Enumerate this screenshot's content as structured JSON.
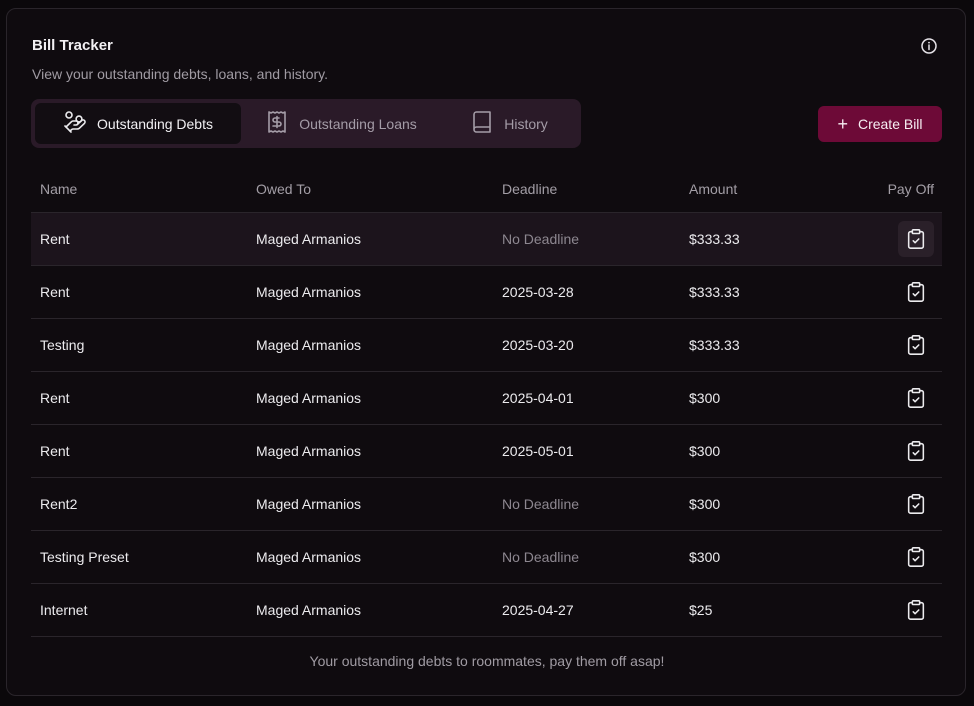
{
  "header": {
    "title": "Bill Tracker",
    "subtitle": "View your outstanding debts, loans, and history."
  },
  "tabs": [
    {
      "label": "Outstanding Debts",
      "icon": "hand-coins-icon",
      "active": true
    },
    {
      "label": "Outstanding Loans",
      "icon": "receipt-icon",
      "active": false
    },
    {
      "label": "History",
      "icon": "book-icon",
      "active": false
    }
  ],
  "create_button": {
    "label": "Create Bill",
    "icon": "plus-icon"
  },
  "table": {
    "columns": [
      "Name",
      "Owed To",
      "Deadline",
      "Amount",
      "Pay Off"
    ],
    "rows": [
      {
        "name": "Rent",
        "owed_to": "Maged Armanios",
        "deadline": "No Deadline",
        "amount": "$333.33"
      },
      {
        "name": "Rent",
        "owed_to": "Maged Armanios",
        "deadline": "2025-03-28",
        "amount": "$333.33"
      },
      {
        "name": "Testing",
        "owed_to": "Maged Armanios",
        "deadline": "2025-03-20",
        "amount": "$333.33"
      },
      {
        "name": "Rent",
        "owed_to": "Maged Armanios",
        "deadline": "2025-04-01",
        "amount": "$300"
      },
      {
        "name": "Rent",
        "owed_to": "Maged Armanios",
        "deadline": "2025-05-01",
        "amount": "$300"
      },
      {
        "name": "Rent2",
        "owed_to": "Maged Armanios",
        "deadline": "No Deadline",
        "amount": "$300"
      },
      {
        "name": "Testing Preset",
        "owed_to": "Maged Armanios",
        "deadline": "No Deadline",
        "amount": "$300"
      },
      {
        "name": "Internet",
        "owed_to": "Maged Armanios",
        "deadline": "2025-04-27",
        "amount": "$25"
      }
    ]
  },
  "footer": "Your outstanding debts to roommates, pay them off asap!",
  "colors": {
    "accent": "#6d0a37",
    "background": "#0f0b0f",
    "tab_bar": "#2a1a28"
  }
}
